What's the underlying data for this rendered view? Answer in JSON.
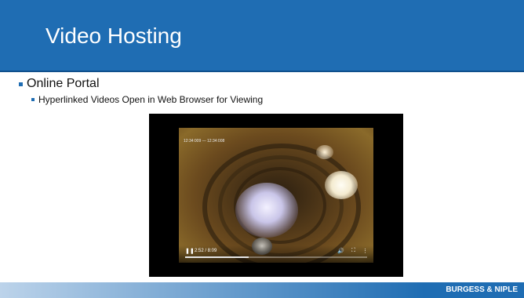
{
  "slide": {
    "title": "Video Hosting",
    "bullets": [
      {
        "text": "Online Portal",
        "children": [
          {
            "text": "Hyperlinked Videos Open in Web Browser for Viewing"
          }
        ]
      }
    ]
  },
  "video": {
    "timestamp": "12:34:009 — 12:34:008",
    "time_display": "2:52 / 8:09",
    "progress": 0.35,
    "icons": {
      "play": "pause-icon",
      "volume": "volume-icon",
      "fullscreen": "fullscreen-icon",
      "more": "more-vertical-icon"
    }
  },
  "footer": {
    "logo": "BURGESS & NIPLE"
  },
  "colors": {
    "accent": "#1f6db3",
    "text": "#111111",
    "white": "#ffffff"
  }
}
